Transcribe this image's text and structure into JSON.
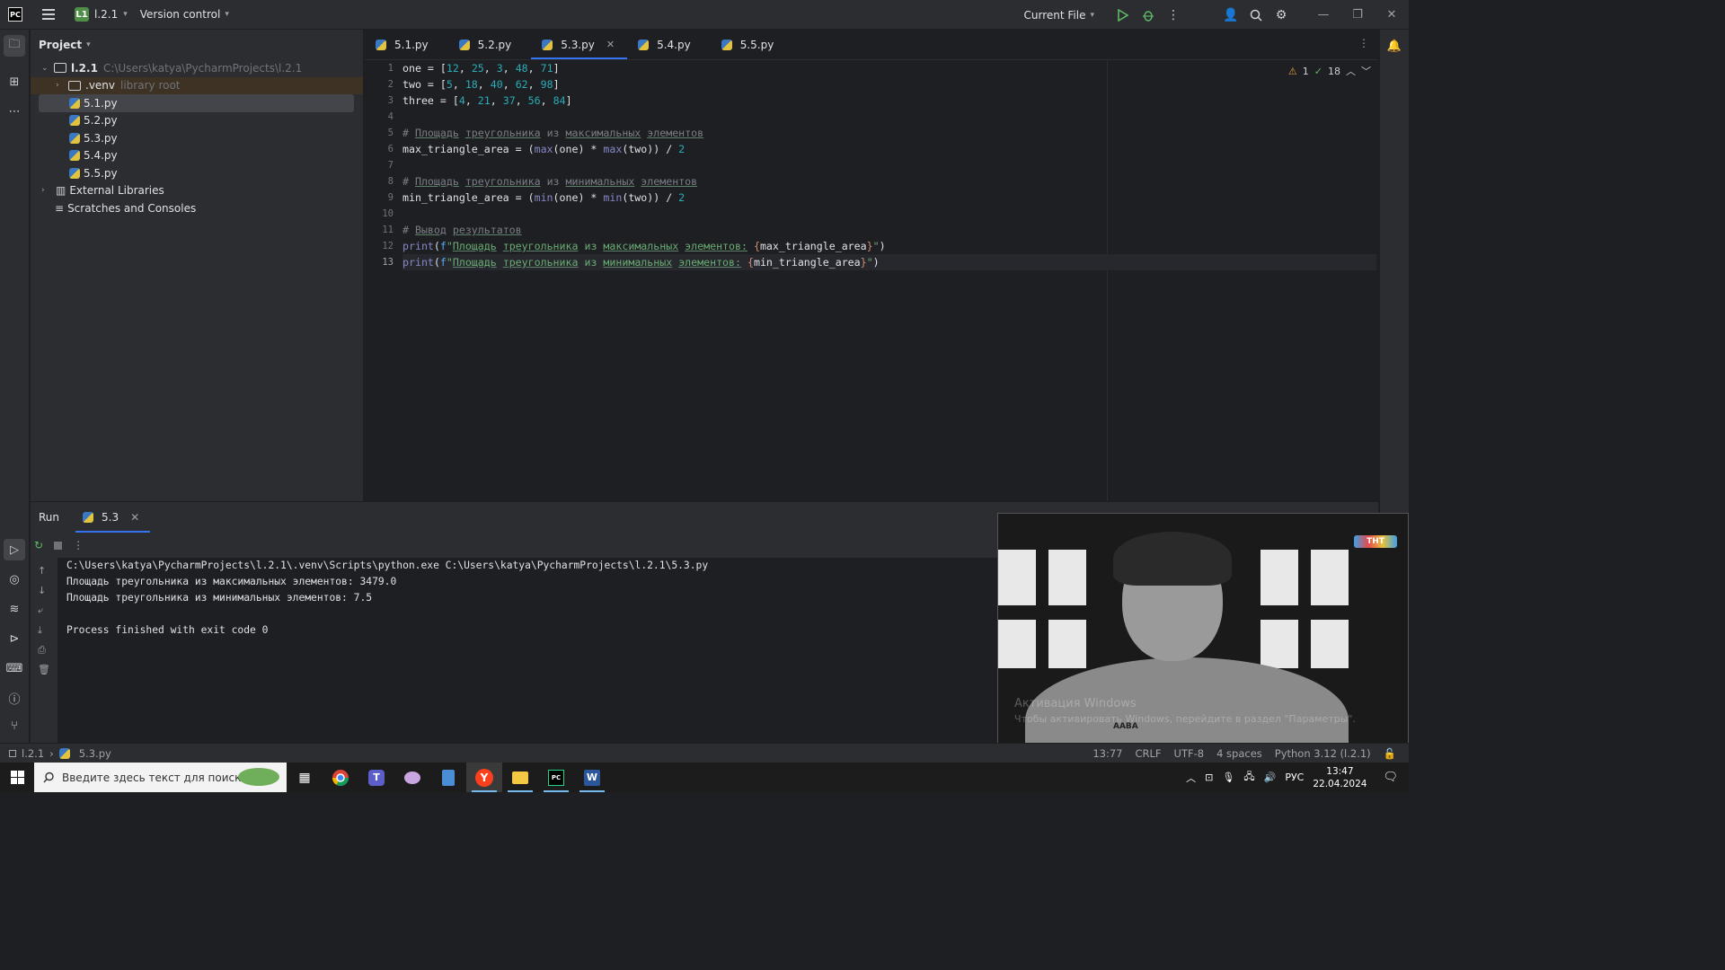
{
  "titlebar": {
    "logo": "PC",
    "project_badge": "L1",
    "project_name": "l.2.1",
    "vcs": "Version control",
    "run_config": "Current File"
  },
  "project_pane": {
    "title": "Project",
    "root_name": "l.2.1",
    "root_path": "C:\\Users\\katya\\PycharmProjects\\l.2.1",
    "venv_name": ".venv",
    "venv_hint": "library root",
    "files": [
      "5.1.py",
      "5.2.py",
      "5.3.py",
      "5.4.py",
      "5.5.py"
    ],
    "external": "External Libraries",
    "scratches": "Scratches and Consoles"
  },
  "editor": {
    "tabs": [
      "5.1.py",
      "5.2.py",
      "5.3.py",
      "5.4.py",
      "5.5.py"
    ],
    "active_tab": "5.3.py",
    "warnings": "1",
    "checks": "18",
    "line_numbers": [
      "1",
      "2",
      "3",
      "4",
      "5",
      "6",
      "7",
      "8",
      "9",
      "10",
      "11",
      "12",
      "13"
    ],
    "code": {
      "l1_var": "one",
      "l1_nums": [
        "12",
        "25",
        "3",
        "48",
        "71"
      ],
      "l2_var": "two",
      "l2_nums": [
        "5",
        "18",
        "40",
        "62",
        "98"
      ],
      "l3_var": "three",
      "l3_nums": [
        "4",
        "21",
        "37",
        "56",
        "84"
      ],
      "l5_comment_words": [
        "Площадь",
        "треугольника",
        "из",
        "максимальных",
        "элементов"
      ],
      "l6_var": "max_triangle_area",
      "l6_fn": "max",
      "l6_div": "2",
      "l8_comment_words": [
        "Площадь",
        "треугольника",
        "из",
        "минимальных",
        "элементов"
      ],
      "l9_var": "min_triangle_area",
      "l9_fn": "min",
      "l9_div": "2",
      "l11_comment_words": [
        "Вывод",
        "результатов"
      ],
      "l12_words": [
        "Площадь",
        "треугольника",
        "из",
        "максимальных",
        "элементов:"
      ],
      "l12_expr": "max_triangle_area",
      "l13_words": [
        "Площадь",
        "треугольника",
        "из",
        "минимальных",
        "элементов:"
      ],
      "l13_expr": "min_triangle_area"
    }
  },
  "run_panel": {
    "title": "Run",
    "config_tab": "5.3",
    "output": [
      "C:\\Users\\katya\\PycharmProjects\\l.2.1\\.venv\\Scripts\\python.exe C:\\Users\\katya\\PycharmProjects\\l.2.1\\5.3.py",
      "Площадь треугольника из максимальных элементов: 3479.0",
      "Площадь треугольника из минимальных элементов: 7.5",
      "",
      "Process finished with exit code 0"
    ]
  },
  "video_overlay": {
    "logo_text": "ТНТ",
    "watermark_line1": "Активация Windows",
    "watermark_line2": "Чтобы активировать Windows, перейдите в раздел \"Параметры\".",
    "caption": "ААВА"
  },
  "statusbar": {
    "project": "l.2.1",
    "file": "5.3.py",
    "position": "13:77",
    "line_sep": "CRLF",
    "encoding": "UTF-8",
    "indent": "4 spaces",
    "interpreter": "Python 3.12 (l.2.1)"
  },
  "taskbar": {
    "search_placeholder": "Введите здесь текст для поиска",
    "lang": "РУС",
    "time": "13:47",
    "date": "22.04.2024"
  }
}
